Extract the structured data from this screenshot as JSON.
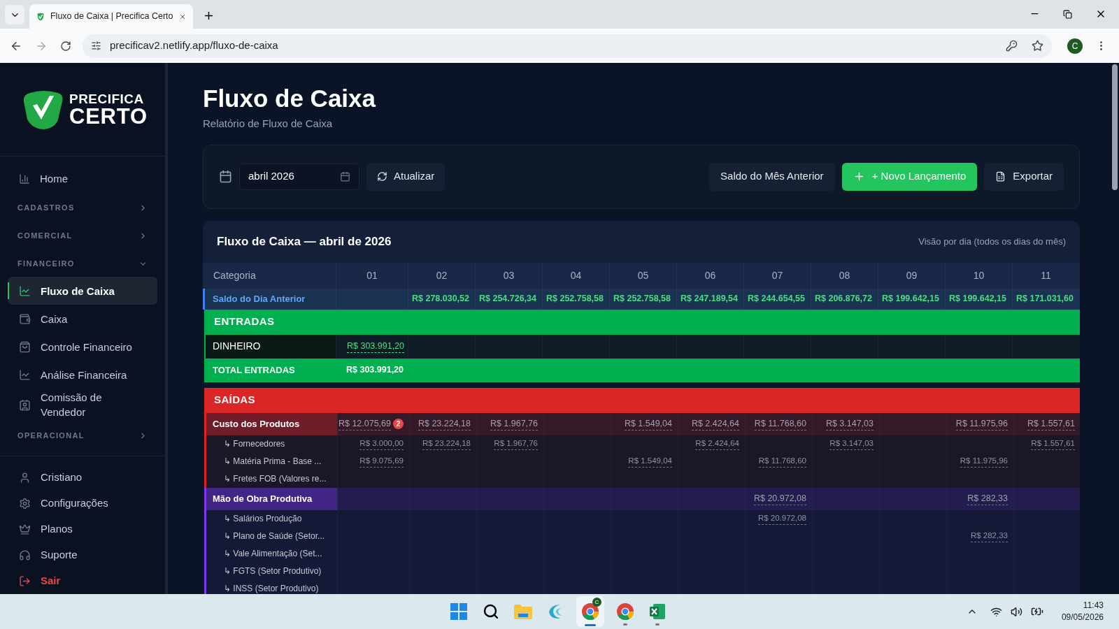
{
  "browser": {
    "tab_title": "Fluxo de Caixa | Precifica Certo",
    "url": "precificav2.netlify.app/fluxo-de-caixa",
    "profile_initial": "C"
  },
  "sidebar": {
    "logo_top": "PRECIFICA",
    "logo_bottom": "CERTO",
    "items": [
      {
        "kind": "link",
        "label": "Home",
        "selected": false
      },
      {
        "kind": "category",
        "label": "CADASTROS",
        "expanded": false
      },
      {
        "kind": "category",
        "label": "COMERCIAL",
        "expanded": false
      },
      {
        "kind": "category",
        "label": "FINANCEIRO",
        "expanded": true,
        "children": [
          {
            "label": "Fluxo de Caixa",
            "selected": true
          },
          {
            "label": "Caixa",
            "selected": false
          },
          {
            "label": "Controle Financeiro",
            "selected": false
          },
          {
            "label": "Análise Financeira",
            "selected": false
          },
          {
            "label": "Comissão de Vendedor",
            "selected": false
          }
        ]
      },
      {
        "kind": "category",
        "label": "OPERACIONAL",
        "expanded": false
      }
    ],
    "footer_items": [
      {
        "kind": "link",
        "label": "Cristiano"
      },
      {
        "kind": "link",
        "label": "Configurações"
      },
      {
        "kind": "link",
        "label": "Planos"
      },
      {
        "kind": "link",
        "label": "Suporte"
      },
      {
        "kind": "danger",
        "label": "Sair"
      }
    ]
  },
  "header": {
    "title": "Fluxo de Caixa",
    "subtitle": "Relatório de Fluxo de Caixa"
  },
  "toolbar": {
    "month": "abril 2026",
    "refresh": "Atualizar",
    "buttons": [
      {
        "kind": "secondary",
        "label": "Saldo do Mês Anterior"
      },
      {
        "kind": "primary",
        "label": "+ Novo Lançamento"
      },
      {
        "kind": "export",
        "label": "Exportar"
      }
    ]
  },
  "table": {
    "title": "Fluxo de Caixa — abril de 2026",
    "view_note": "Visão por dia (todos os dias do mês)",
    "columns": [
      "Categoria",
      "01",
      "02",
      "03",
      "04",
      "05",
      "06",
      "07",
      "08",
      "09",
      "10",
      "11"
    ],
    "rows": [
      {
        "kind": "balance",
        "label": "Saldo do Dia Anterior",
        "cells": [
          {
            "kind": "blank"
          },
          {
            "kind": "amount",
            "text": "R$ 278.030,52"
          },
          {
            "kind": "amount",
            "text": "R$ 254.726,34"
          },
          {
            "kind": "amount",
            "text": "R$ 252.758,58"
          },
          {
            "kind": "amount",
            "text": "R$ 252.758,58"
          },
          {
            "kind": "amount",
            "text": "R$ 247.189,54"
          },
          {
            "kind": "amount",
            "text": "R$ 244.654,55"
          },
          {
            "kind": "amount",
            "text": "R$ 206.876,72"
          },
          {
            "kind": "amount",
            "text": "R$ 199.642,15"
          },
          {
            "kind": "amount",
            "text": "R$ 199.642,15"
          },
          {
            "kind": "amount",
            "text": "R$ 171.031,60"
          }
        ]
      },
      {
        "kind": "section",
        "label": "ENTRADAS",
        "color": "#00b050"
      },
      {
        "kind": "item",
        "label": "DINHEIRO",
        "color": "#00b050",
        "cells": [
          {
            "kind": "amount",
            "text": "R$ 303.991,20"
          },
          {
            "kind": "blank"
          },
          {
            "kind": "blank"
          },
          {
            "kind": "blank"
          },
          {
            "kind": "blank"
          },
          {
            "kind": "blank"
          },
          {
            "kind": "blank"
          },
          {
            "kind": "blank"
          },
          {
            "kind": "blank"
          },
          {
            "kind": "blank"
          },
          {
            "kind": "blank"
          }
        ]
      },
      {
        "kind": "total",
        "label": "TOTAL ENTRADAS",
        "color": "#00b050",
        "cells": [
          {
            "kind": "amount",
            "text": "R$ 303.991,20"
          },
          {
            "kind": "blank"
          },
          {
            "kind": "blank"
          },
          {
            "kind": "blank"
          },
          {
            "kind": "blank"
          },
          {
            "kind": "blank"
          },
          {
            "kind": "blank"
          },
          {
            "kind": "blank"
          },
          {
            "kind": "blank"
          },
          {
            "kind": "blank"
          },
          {
            "kind": "blank"
          }
        ]
      },
      {
        "kind": "section",
        "label": "SAÍDAS",
        "color": "#dc2626"
      },
      {
        "kind": "group",
        "label": "Custo dos Produtos",
        "color": "#dc2626",
        "cells": [
          {
            "kind": "amount",
            "text": "R$ 12.075,69",
            "badge": "2"
          },
          {
            "kind": "amount",
            "text": "R$ 23.224,18"
          },
          {
            "kind": "amount",
            "text": "R$ 1.967,76"
          },
          {
            "kind": "blank"
          },
          {
            "kind": "amount",
            "text": "R$ 1.549,04"
          },
          {
            "kind": "amount",
            "text": "R$ 2.424,64"
          },
          {
            "kind": "amount",
            "text": "R$ 11.768,60"
          },
          {
            "kind": "amount",
            "text": "R$ 3.147,03"
          },
          {
            "kind": "blank"
          },
          {
            "kind": "amount",
            "text": "R$ 11.975,96"
          },
          {
            "kind": "amount",
            "text": "R$ 1.557,61"
          }
        ],
        "children": [
          {
            "label": "↳ Fornecedores",
            "cells": [
              {
                "kind": "amount",
                "text": "R$ 3.000,00"
              },
              {
                "kind": "amount",
                "text": "R$ 23.224,18"
              },
              {
                "kind": "amount",
                "text": "R$ 1.967,76"
              },
              {
                "kind": "blank"
              },
              {
                "kind": "blank"
              },
              {
                "kind": "amount",
                "text": "R$ 2.424,64"
              },
              {
                "kind": "blank"
              },
              {
                "kind": "amount",
                "text": "R$ 3.147,03"
              },
              {
                "kind": "blank"
              },
              {
                "kind": "blank"
              },
              {
                "kind": "amount",
                "text": "R$ 1.557,61"
              }
            ]
          },
          {
            "label": "↳ Matéria Prima - Base ...",
            "cells": [
              {
                "kind": "amount",
                "text": "R$ 9.075,69"
              },
              {
                "kind": "blank"
              },
              {
                "kind": "blank"
              },
              {
                "kind": "blank"
              },
              {
                "kind": "amount",
                "text": "R$ 1.549,04"
              },
              {
                "kind": "blank"
              },
              {
                "kind": "amount",
                "text": "R$ 11.768,60"
              },
              {
                "kind": "blank"
              },
              {
                "kind": "blank"
              },
              {
                "kind": "amount",
                "text": "R$ 11.975,96"
              },
              {
                "kind": "blank"
              }
            ]
          },
          {
            "label": "↳ Fretes FOB (Valores re..."
          }
        ]
      },
      {
        "kind": "group",
        "label": "Mão de Obra Produtiva",
        "color": "#7c3aed",
        "cells": [
          {
            "kind": "blank"
          },
          {
            "kind": "blank"
          },
          {
            "kind": "blank"
          },
          {
            "kind": "blank"
          },
          {
            "kind": "blank"
          },
          {
            "kind": "blank"
          },
          {
            "kind": "amount",
            "text": "R$ 20.972,08"
          },
          {
            "kind": "blank"
          },
          {
            "kind": "blank"
          },
          {
            "kind": "amount",
            "text": "R$ 282,33"
          },
          {
            "kind": "blank"
          }
        ],
        "children": [
          {
            "label": "↳ Salários Produção",
            "cells": [
              {
                "kind": "blank"
              },
              {
                "kind": "blank"
              },
              {
                "kind": "blank"
              },
              {
                "kind": "blank"
              },
              {
                "kind": "blank"
              },
              {
                "kind": "blank"
              },
              {
                "kind": "amount",
                "text": "R$ 20.972,08"
              },
              {
                "kind": "blank"
              },
              {
                "kind": "blank"
              },
              {
                "kind": "blank"
              },
              {
                "kind": "blank"
              }
            ]
          },
          {
            "label": "↳ Plano de Saúde (Setor...",
            "cells": [
              {
                "kind": "blank"
              },
              {
                "kind": "blank"
              },
              {
                "kind": "blank"
              },
              {
                "kind": "blank"
              },
              {
                "kind": "blank"
              },
              {
                "kind": "blank"
              },
              {
                "kind": "blank"
              },
              {
                "kind": "blank"
              },
              {
                "kind": "blank"
              },
              {
                "kind": "amount",
                "text": "R$ 282,33"
              },
              {
                "kind": "blank"
              }
            ]
          },
          {
            "label": "↳ Vale Alimentação (Set..."
          },
          {
            "label": "↳ FGTS (Setor Produtivo)"
          },
          {
            "label": "↳ INSS (Setor Produtivo)"
          }
        ]
      }
    ]
  },
  "taskbar": {
    "badge": "C",
    "time": "11:43",
    "date": "09/05/2026"
  }
}
